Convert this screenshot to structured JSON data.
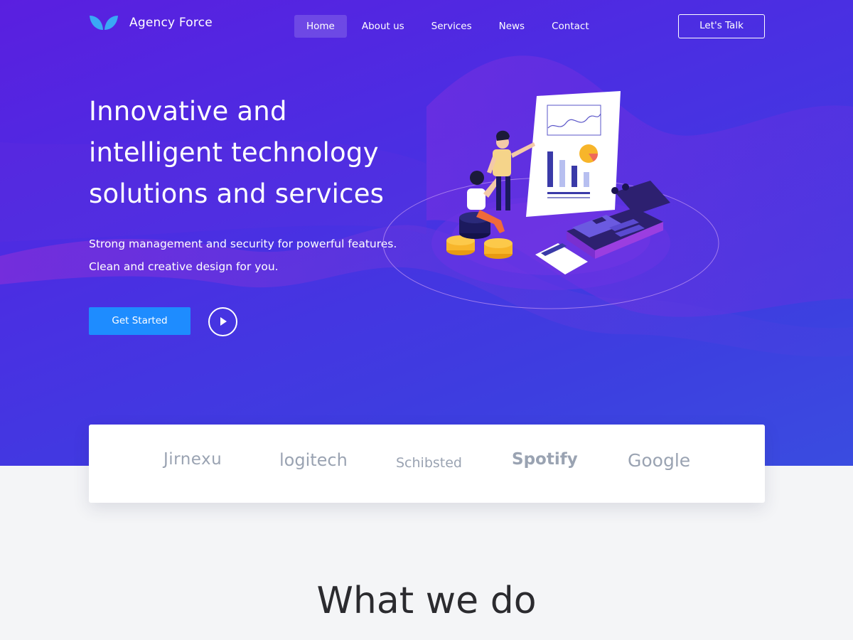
{
  "brand": {
    "name": "Agency Force",
    "accent": "#1e8cff",
    "logo_color": "#3aa8f5"
  },
  "nav": {
    "items": [
      {
        "label": "Home",
        "active": true
      },
      {
        "label": "About us",
        "active": false
      },
      {
        "label": "Services",
        "active": false
      },
      {
        "label": "News",
        "active": false
      },
      {
        "label": "Contact",
        "active": false
      }
    ],
    "cta_label": "Let's Talk"
  },
  "hero": {
    "title_lines": [
      "Innovative and",
      "intelligent technology",
      "solutions and services"
    ],
    "subtitle_lines": [
      "Strong management and security for powerful features.",
      "Clean and creative design for you."
    ],
    "primary_button": "Get Started",
    "play_icon": "play-icon"
  },
  "partners": [
    "Jirnexu",
    "logitech",
    "Schibsted",
    "Spotify",
    "Google"
  ],
  "section": {
    "title": "What we do"
  }
}
